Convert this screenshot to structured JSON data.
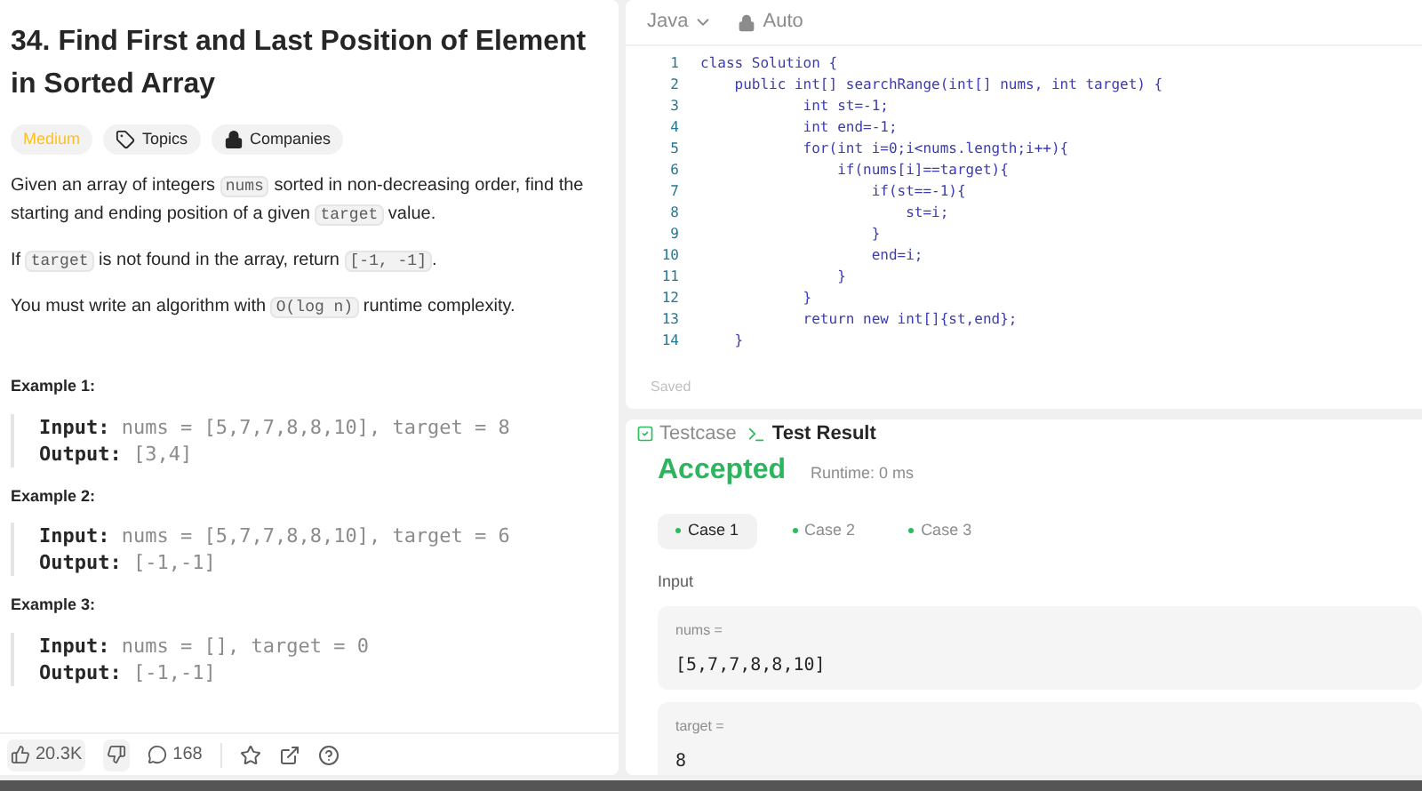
{
  "problem": {
    "title": "34. Find First and Last Position of Element in Sorted Array",
    "tags": [
      {
        "label": "Medium",
        "kind": "difficulty"
      },
      {
        "label": "Topics",
        "kind": "topics"
      },
      {
        "label": "Companies",
        "kind": "companies"
      }
    ],
    "paragraphs": [
      [
        {
          "text": "Given an array of integers ",
          "code": false
        },
        {
          "text": "nums",
          "code": true
        },
        {
          "text": " sorted in non-decreasing order, find the starting and ending position of a given ",
          "code": false
        },
        {
          "text": "target",
          "code": true
        },
        {
          "text": " value.",
          "code": false
        }
      ],
      [
        {
          "text": "If ",
          "code": false
        },
        {
          "text": "target",
          "code": true
        },
        {
          "text": " is not found in the array, return ",
          "code": false
        },
        {
          "text": "[-1, -1]",
          "code": true
        },
        {
          "text": ".",
          "code": false
        }
      ],
      [
        {
          "text": "You must write an algorithm with ",
          "code": false
        },
        {
          "text": "O(log n)",
          "code": true
        },
        {
          "text": " runtime complexity.",
          "code": false
        }
      ]
    ],
    "examples": [
      {
        "title": "Example 1:",
        "lines": [
          "**Input:** nums = [5,7,7,8,8,10], target = 8",
          "**Output:** [3,4]"
        ]
      },
      {
        "title": "Example 2:",
        "lines": [
          "**Input:** nums = [5,7,7,8,8,10], target = 6",
          "**Output:** [-1,-1]"
        ]
      },
      {
        "title": "Example 3:",
        "lines": [
          "**Input:** nums = [], target = 0",
          "**Output:** [-1,-1]"
        ]
      }
    ],
    "footer": {
      "likes": "20.3K",
      "comments": "168"
    }
  },
  "editor": {
    "language": "Java",
    "mode": "Auto",
    "status": "Saved",
    "lines": [
      {
        "number": "1",
        "code": "class Solution {"
      },
      {
        "number": "2",
        "code": "    public int[] searchRange(int[] nums, int target) {"
      },
      {
        "number": "3",
        "code": "            int st=-1;"
      },
      {
        "number": "4",
        "code": "            int end=-1;"
      },
      {
        "number": "5",
        "code": "            for(int i=0;i<nums.length;i++){"
      },
      {
        "number": "6",
        "code": "                if(nums[i]==target){"
      },
      {
        "number": "7",
        "code": "                    if(st==-1){"
      },
      {
        "number": "8",
        "code": "                        st=i;"
      },
      {
        "number": "9",
        "code": "                    }"
      },
      {
        "number": "10",
        "code": "                    end=i;"
      },
      {
        "number": "11",
        "code": "                }"
      },
      {
        "number": "12",
        "code": "            }"
      },
      {
        "number": "13",
        "code": "            return new int[]{st,end};"
      },
      {
        "number": "14",
        "code": "    }"
      }
    ]
  },
  "tests": {
    "tabs": [
      {
        "label": "Testcase",
        "selected": false
      },
      {
        "label": "Test Result",
        "selected": true
      }
    ],
    "verdict": "Accepted",
    "runtime": "Runtime: 0 ms",
    "cases": [
      {
        "label": "Case 1",
        "selected": true
      },
      {
        "label": "Case 2",
        "selected": false
      },
      {
        "label": "Case 3",
        "selected": false
      }
    ],
    "input_heading": "Input",
    "inputs": [
      {
        "name": "nums =",
        "value": "[5,7,7,8,8,10]"
      },
      {
        "name": "target =",
        "value": "8"
      }
    ]
  }
}
